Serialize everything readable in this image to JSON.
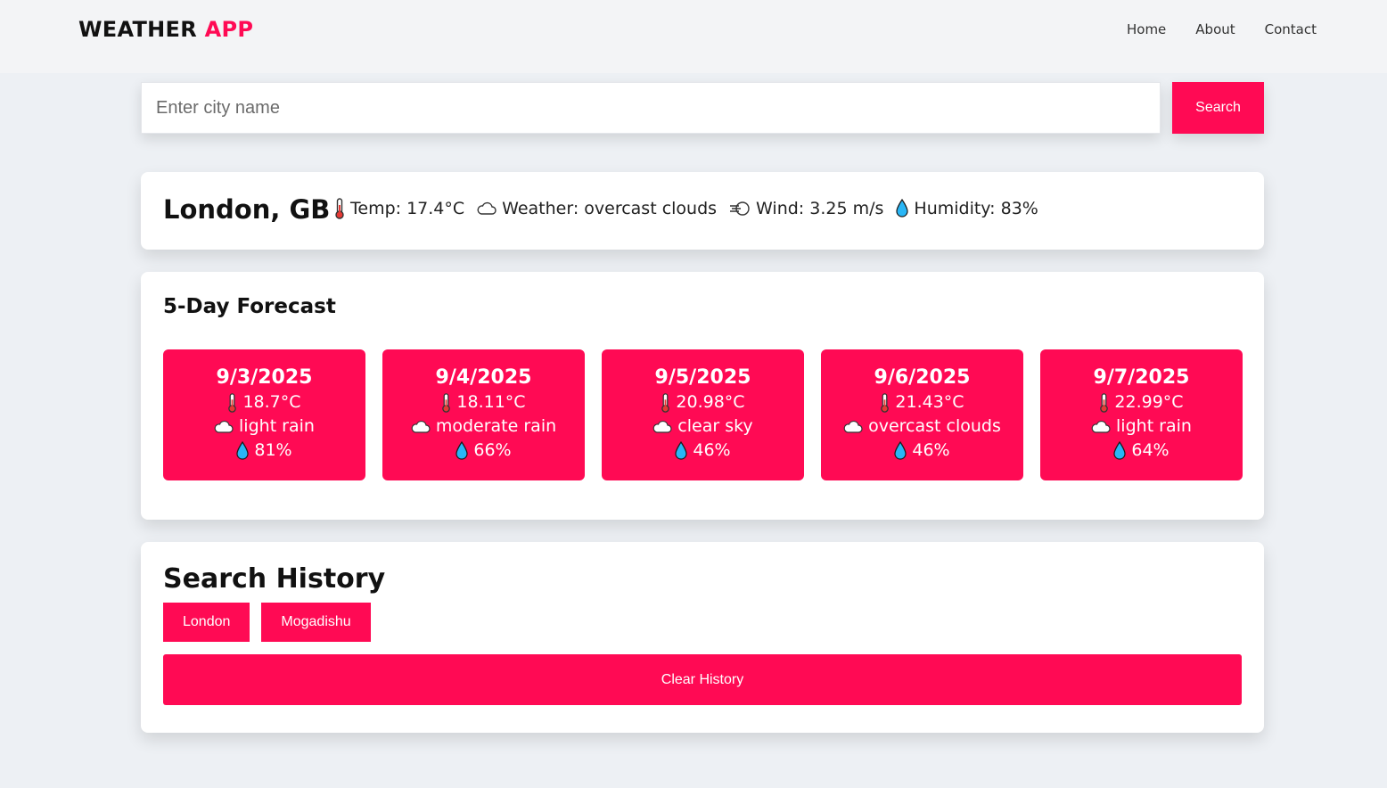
{
  "header": {
    "logo_main": "WEATHER",
    "logo_accent": "APP",
    "nav": [
      "Home",
      "About",
      "Contact"
    ]
  },
  "search": {
    "placeholder": "Enter city name",
    "value": "",
    "button_label": "Search"
  },
  "current": {
    "city": "London, GB",
    "temp_text": "Temp: 17.4°C",
    "weather_text": "Weather: overcast clouds",
    "wind_text": "Wind: 3.25 m/s",
    "humidity_text": "Humidity: 83%",
    "icons": [
      "thermometer-icon",
      "cloud-icon",
      "wind-icon",
      "droplet-icon"
    ]
  },
  "forecast": {
    "title": "5-Day Forecast",
    "days": [
      {
        "date": "9/3/2025",
        "temp": "18.7°C",
        "desc": "light rain",
        "humidity": "81%"
      },
      {
        "date": "9/4/2025",
        "temp": "18.11°C",
        "desc": "moderate rain",
        "humidity": "66%"
      },
      {
        "date": "9/5/2025",
        "temp": "20.98°C",
        "desc": "clear sky",
        "humidity": "46%"
      },
      {
        "date": "9/6/2025",
        "temp": "21.43°C",
        "desc": "overcast clouds",
        "humidity": "46%"
      },
      {
        "date": "9/7/2025",
        "temp": "22.99°C",
        "desc": "light rain",
        "humidity": "64%"
      }
    ]
  },
  "history": {
    "title": "Search History",
    "items": [
      "London",
      "Mogadishu"
    ],
    "clear_label": "Clear History"
  },
  "colors": {
    "accent": "#ff0a54",
    "page_bg": "#edf0f4",
    "card_bg": "#ffffff",
    "navbar_bg": "#f3f4f6"
  }
}
